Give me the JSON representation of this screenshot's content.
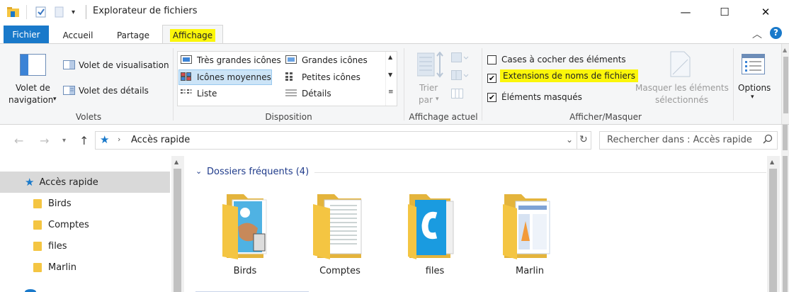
{
  "window": {
    "title": "Explorateur de fichiers",
    "controls": {
      "minimize": "—",
      "maximize": "☐",
      "close": "✕"
    }
  },
  "tabs": [
    {
      "label": "Fichier"
    },
    {
      "label": "Accueil"
    },
    {
      "label": "Partage"
    },
    {
      "label": "Affichage"
    }
  ],
  "ribbon": {
    "volets": {
      "nav_line1": "Volet de",
      "nav_line2": "navigation",
      "preview": "Volet de visualisation",
      "details": "Volet des détails",
      "group": "Volets"
    },
    "disposition": {
      "items": [
        "Très grandes icônes",
        "Grandes icônes",
        "Icônes moyennes",
        "Petites icônes",
        "Liste",
        "Détails"
      ],
      "group": "Disposition"
    },
    "affichage_actuel": {
      "sort_line1": "Trier",
      "sort_line2": "par",
      "group": "Affichage actuel"
    },
    "afficher_masquer": {
      "checkboxes": [
        {
          "label": "Cases à cocher des éléments",
          "checked": false
        },
        {
          "label": "Extensions de noms de fichiers",
          "checked": true
        },
        {
          "label": "Éléments masqués",
          "checked": true
        }
      ],
      "hide_line1": "Masquer les éléments",
      "hide_line2": "sélectionnés",
      "group": "Afficher/Masquer"
    },
    "options": {
      "label": "Options"
    }
  },
  "address": {
    "location": "Accès rapide",
    "search_placeholder": "Rechercher dans : Accès rapide"
  },
  "navpane": {
    "items": [
      {
        "label": "Accès rapide"
      },
      {
        "label": "Birds"
      },
      {
        "label": "Comptes"
      },
      {
        "label": "files"
      },
      {
        "label": "Marlin"
      }
    ]
  },
  "content": {
    "group_title": "Dossiers fréquents (4)",
    "folders": [
      {
        "label": "Birds"
      },
      {
        "label": "Comptes"
      },
      {
        "label": "files"
      },
      {
        "label": "Marlin"
      }
    ]
  },
  "colors": {
    "file_tab": "#1979ca",
    "highlight": "#fbf60a",
    "folder": "#f4c542",
    "group_heading": "#1e3a8a"
  }
}
